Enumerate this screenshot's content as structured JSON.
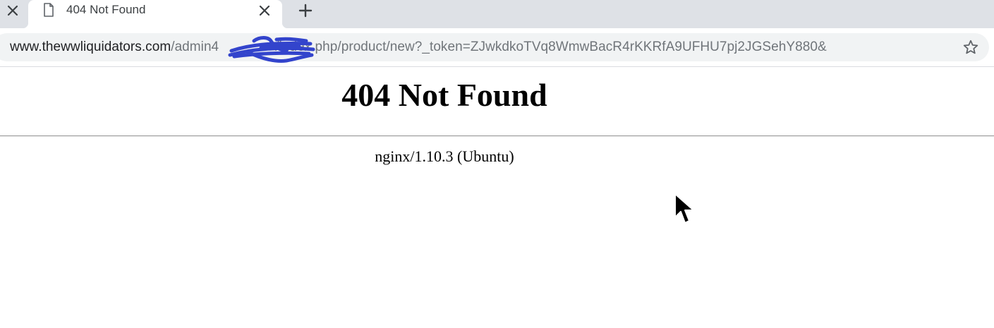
{
  "browser": {
    "tabs": [
      {
        "title": "",
        "active": false
      },
      {
        "title": "404 Not Found",
        "active": true
      }
    ],
    "icons": {
      "close": "close-icon",
      "page": "page-icon",
      "new_tab": "plus-icon",
      "bookmark": "star-icon"
    },
    "address_bar": {
      "domain": "www.thewwliquidators.com",
      "path_before_redaction": "/admin4",
      "path_after_redaction": "/index.php/product/new?_token=ZJwkdkoTVq8WmwBacR4rKKRfA9UFHU7pj2JGSehY880&",
      "redaction_color": "#3344cc"
    }
  },
  "page": {
    "heading": "404 Not Found",
    "server_signature": "nginx/1.10.3 (Ubuntu)"
  },
  "colors": {
    "tabstrip_bg": "#dee1e6",
    "omnibox_bg": "#f1f3f4",
    "url_domain": "#202124",
    "url_path": "#70757a"
  }
}
